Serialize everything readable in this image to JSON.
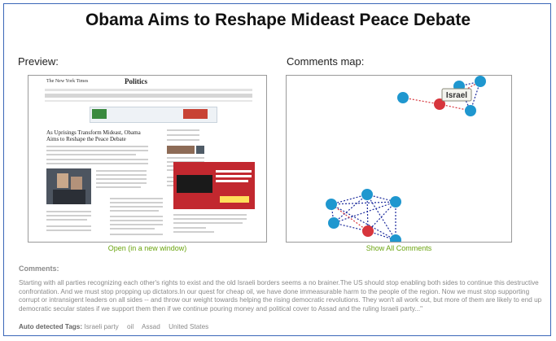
{
  "title": "Obama Aims to Reshape Mideast Peace Debate",
  "preview": {
    "label": "Preview:",
    "link": "Open (in a new window)",
    "thumbnail": {
      "newspaper": "The New York Times",
      "section": "Politics",
      "headline": "As Uprisings Transform Mideast, Obama Aims to Reshape the Peace Debate",
      "ad_headline": "BUSINESS CLASS CAREER",
      "ad_button": "Find out more"
    }
  },
  "map": {
    "label": "Comments map:",
    "node_label": "Israel",
    "link": "Show All Comments",
    "colors": {
      "node": "#1f97cf",
      "hub": "#d7353c",
      "edge": "#1b2a9c",
      "hub_edge": "#d7353c"
    }
  },
  "comments": {
    "label": "Comments:",
    "text": "Starting with all parties recognizing each other's rights to exist and the old Israeli borders seems a no brainer.The US should stop enabling both sides to continue this destructive confrontation. And we must stop propping up dictators.In our quest for cheap oil, we have done immeasurable harm to the people of the region. Now we must stop supporting corrupt or intransigent leaders on all sides -- and throw our weight towards helping the rising democratic revolutions. They won't all work out, but more of them are likely to end up democratic secular states if we support them then if we continue pouring money and political cover to Assad and the ruling Israeli party...\"",
    "tags_label": "Auto detected Tags:",
    "tags": [
      "Israeli party",
      "oil",
      "Assad",
      "United States"
    ]
  }
}
